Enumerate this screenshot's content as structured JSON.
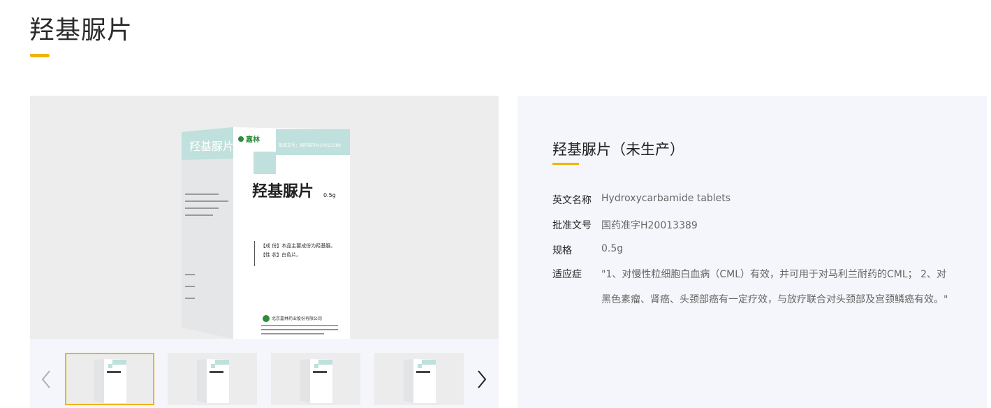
{
  "page": {
    "title": "羟基脲片",
    "accent_color": "#f0b400"
  },
  "box": {
    "brand": "嘉林",
    "approval_text": "批准文号：国药准字H20013389",
    "name": "羟基脲片",
    "spec": "0.5g",
    "side_name": "羟基脲片",
    "composition": "【成 份】本品主要成份为羟基脲。",
    "character": "【性 状】白色片。",
    "company": "北京嘉林药业股份有限公司"
  },
  "gallery": {
    "prev_icon": "chevron-left-icon",
    "next_icon": "chevron-right-icon",
    "thumb_count": 4,
    "active_index": 0
  },
  "product": {
    "name": "羟基脲片（未生产）",
    "attributes": [
      {
        "label": "英文名称",
        "value": "Hydroxycarbamide tablets"
      },
      {
        "label": "批准文号",
        "value": "国药准字H20013389"
      },
      {
        "label": "规格",
        "value": "0.5g"
      },
      {
        "label": "适应症",
        "value": "\"1、对慢性粒细胞白血病（CML）有效，并可用于对马利兰耐药的CML； 2、对黑色素瘤、肾癌、头颈部癌有一定疗效，与放疗联合对头颈部及宫颈鳞癌有效。\""
      }
    ]
  }
}
